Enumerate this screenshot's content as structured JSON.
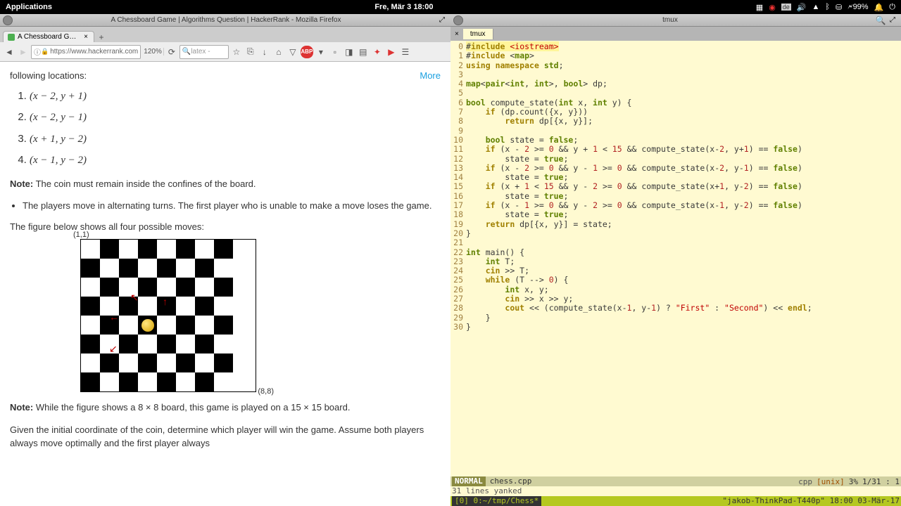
{
  "menubar": {
    "apps": "Applications",
    "clock": "Fre, Mär 3  18:00",
    "battery": "99%"
  },
  "firefox": {
    "window_title": "A Chessboard Game | Algorithms Question | HackerRank - Mozilla Firefox",
    "tab_title": "A Chessboard Game | Al…",
    "url": "https://www.hackerrank.com",
    "zoom": "120%",
    "search_placeholder": "latex -"
  },
  "problem": {
    "intro": "following locations:",
    "moves": [
      "(x − 2, y + 1)",
      "(x − 2, y − 1)",
      "(x + 1, y − 2)",
      "(x − 1, y − 2)"
    ],
    "note1_label": "Note:",
    "note1_text": " The coin must remain inside the confines of the board.",
    "bullet1": "The players move in alternating turns. The first player who is unable to make a move loses the game.",
    "fig_caption": "The figure below shows all four possible moves:",
    "board_tl": "(1,1)",
    "board_br": "(8,8)",
    "note2_label": "Note:",
    "note2_text": " While the figure shows a 8 × 8 board, this game is played on a 15 × 15 board.",
    "outro": "Given the initial coordinate of the coin, determine which player will win the game. Assume both players always move optimally and the first player always",
    "more": "More"
  },
  "tmux": {
    "window_title": "tmux",
    "tab": "tmux",
    "code_lines": [
      {
        "n": 0,
        "t": [
          "#include ",
          "<iostream>"
        ]
      },
      {
        "n": 1,
        "t": [
          "#include ",
          "<map>"
        ]
      },
      {
        "n": 2,
        "t": [
          "using namespace std;"
        ]
      },
      {
        "n": 3,
        "t": [
          ""
        ]
      },
      {
        "n": 4,
        "t": [
          "map<pair<int, int>, bool> dp;"
        ]
      },
      {
        "n": 5,
        "t": [
          ""
        ]
      },
      {
        "n": 6,
        "t": [
          "bool compute_state(int x, int y) {"
        ]
      },
      {
        "n": 7,
        "t": [
          "    if (dp.count({x, y}))"
        ]
      },
      {
        "n": 8,
        "t": [
          "        return dp[{x, y}];"
        ]
      },
      {
        "n": 9,
        "t": [
          ""
        ]
      },
      {
        "n": 10,
        "t": [
          "    bool state = false;"
        ]
      },
      {
        "n": 11,
        "t": [
          "    if (x - 2 >= 0 && y + 1 < 15 && compute_state(x-2, y+1) == false)"
        ]
      },
      {
        "n": 12,
        "t": [
          "        state = true;"
        ]
      },
      {
        "n": 13,
        "t": [
          "    if (x - 2 >= 0 && y - 1 >= 0 && compute_state(x-2, y-1) == false)"
        ]
      },
      {
        "n": 14,
        "t": [
          "        state = true;"
        ]
      },
      {
        "n": 15,
        "t": [
          "    if (x + 1 < 15 && y - 2 >= 0 && compute_state(x+1, y-2) == false)"
        ]
      },
      {
        "n": 16,
        "t": [
          "        state = true;"
        ]
      },
      {
        "n": 17,
        "t": [
          "    if (x - 1 >= 0 && y - 2 >= 0 && compute_state(x-1, y-2) == false)"
        ]
      },
      {
        "n": 18,
        "t": [
          "        state = true;"
        ]
      },
      {
        "n": 19,
        "t": [
          "    return dp[{x, y}] = state;"
        ]
      },
      {
        "n": 20,
        "t": [
          "}"
        ]
      },
      {
        "n": 21,
        "t": [
          ""
        ]
      },
      {
        "n": 22,
        "t": [
          "int main() {"
        ]
      },
      {
        "n": 23,
        "t": [
          "    int T;"
        ]
      },
      {
        "n": 24,
        "t": [
          "    cin >> T;"
        ]
      },
      {
        "n": 25,
        "t": [
          "    while (T --> 0) {"
        ]
      },
      {
        "n": 26,
        "t": [
          "        int x, y;"
        ]
      },
      {
        "n": 27,
        "t": [
          "        cin >> x >> y;"
        ]
      },
      {
        "n": 28,
        "t": [
          "        cout << (compute_state(x-1, y-1) ? \"First\" : \"Second\") << endl;"
        ]
      },
      {
        "n": 29,
        "t": [
          "    }"
        ]
      },
      {
        "n": 30,
        "t": [
          "}"
        ]
      }
    ],
    "mode": "NORMAL",
    "filename": "chess.cpp",
    "filetype": "cpp",
    "encoding": "[unix]",
    "percent": "3%",
    "position": "1/31 :  1",
    "msg": "31 lines yanked",
    "session": "[0] 0:~/tmp/Chess*",
    "host": "\"jakob-ThinkPad-T440p\" 18:00 03-Mär-17"
  }
}
